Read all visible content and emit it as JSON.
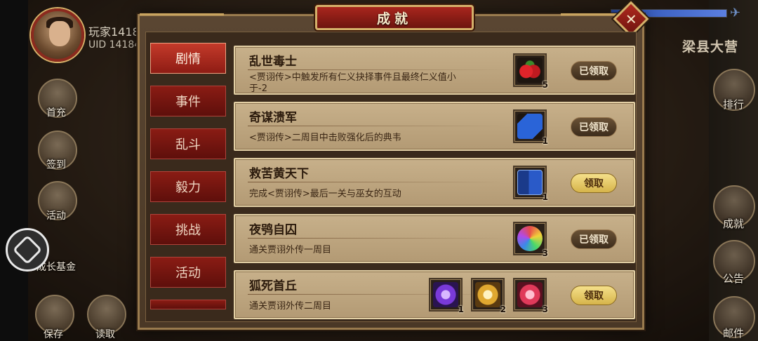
{
  "player": {
    "name": "玩家1418",
    "uid": "UID 14184"
  },
  "location_title": "梁县大营",
  "left_menu": [
    {
      "label": "首充"
    },
    {
      "label": "签到"
    },
    {
      "label": "活动"
    },
    {
      "label": "成长基金"
    },
    {
      "label": "保存"
    },
    {
      "label": "读取"
    }
  ],
  "right_menu": [
    {
      "label": "排行"
    },
    {
      "label": "成就"
    },
    {
      "label": "公告"
    },
    {
      "label": "邮件"
    }
  ],
  "dialog": {
    "title": "成就",
    "tabs": [
      {
        "label": "剧情",
        "active": true
      },
      {
        "label": "事件",
        "active": false
      },
      {
        "label": "乱斗",
        "active": false
      },
      {
        "label": "毅力",
        "active": false
      },
      {
        "label": "挑战",
        "active": false
      },
      {
        "label": "活动",
        "active": false
      }
    ],
    "achievements": [
      {
        "name": "乱世毒士",
        "desc": "<贾诩传>中触发所有仁义抉择事件且最终仁义值小于-2",
        "rewards": [
          {
            "icon": "cherry-icon",
            "count": "5"
          }
        ],
        "button": "已领取",
        "state": "claimed"
      },
      {
        "name": "奇谋溃军",
        "desc": "<贾诩传>二周目中击败强化后的典韦",
        "rewards": [
          {
            "icon": "scroll-icon",
            "count": "1"
          }
        ],
        "button": "已领取",
        "state": "claimed"
      },
      {
        "name": "救苦黄天下",
        "desc": "完成<贾诩传>最后一关与巫女的互动",
        "rewards": [
          {
            "icon": "book-icon",
            "count": "1"
          }
        ],
        "button": "领取",
        "state": "ready"
      },
      {
        "name": "夜鸮自囚",
        "desc": "通关贾诩外传一周目",
        "rewards": [
          {
            "icon": "crystal-ball-icon",
            "count": "3"
          }
        ],
        "button": "已领取",
        "state": "claimed"
      },
      {
        "name": "狐死首丘",
        "desc": "通关贾诩外传二周目",
        "rewards": [
          {
            "icon": "purple-gem-icon",
            "count": "1"
          },
          {
            "icon": "gold-gem-icon",
            "count": "2"
          },
          {
            "icon": "red-gem-icon",
            "count": "3"
          }
        ],
        "button": "领取",
        "state": "ready"
      }
    ]
  },
  "colors": {
    "title_red": "#a8261d",
    "gold_border": "#d4b06a",
    "row_bg": "#c7b08a",
    "claim_ready": "#e8cc68",
    "claim_done": "#4e3a26"
  }
}
